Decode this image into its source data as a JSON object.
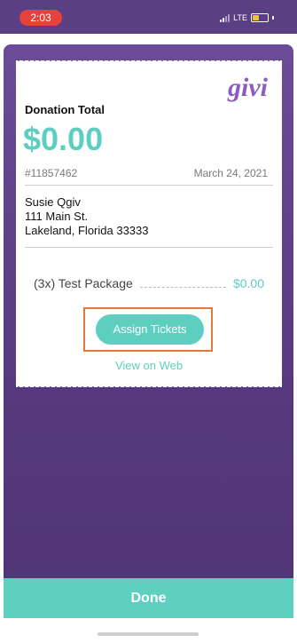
{
  "status_bar": {
    "time": "2:03",
    "network": "LTE"
  },
  "receipt": {
    "brand": "givi",
    "donation_total_label": "Donation Total",
    "donation_total_amount": "$0.00",
    "order_id": "#11857462",
    "date": "March 24, 2021",
    "address": {
      "name": "Susie Qgiv",
      "street": "111 Main St.",
      "city_state_zip": "Lakeland, Florida 33333"
    },
    "line_items": [
      {
        "label": "(3x) Test Package",
        "price": "$0.00"
      }
    ],
    "assign_tickets_label": "Assign Tickets",
    "view_on_web_label": "View on Web"
  },
  "footer": {
    "done_label": "Done"
  },
  "colors": {
    "brand_purple": "#8b5dc3",
    "teal": "#5dcfc0",
    "highlight_orange": "#e07a3a",
    "background_purple": "#5b3f84"
  }
}
